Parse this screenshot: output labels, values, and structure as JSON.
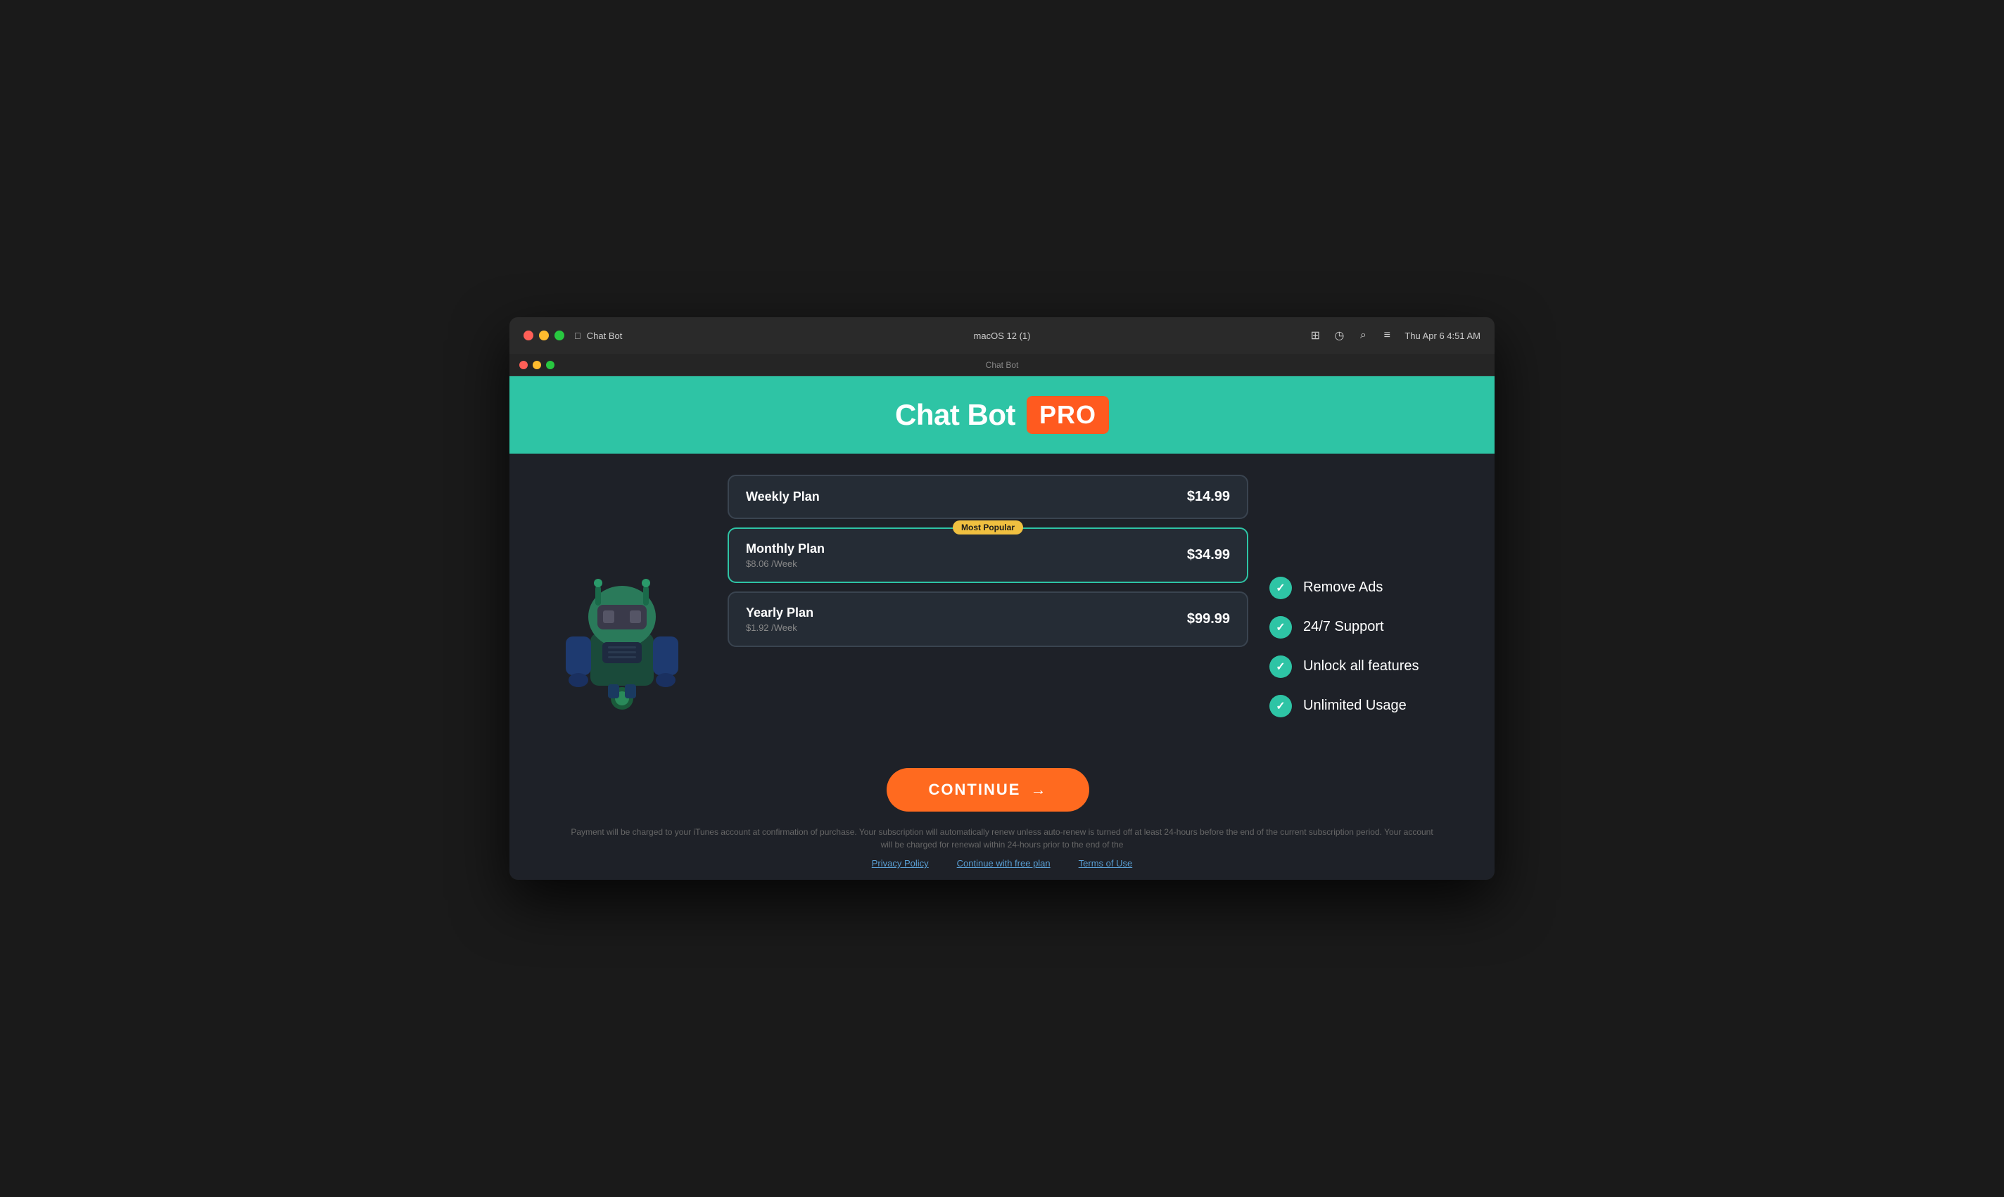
{
  "os": {
    "title": "macOS 12 (1)",
    "app_name": "Chat Bot",
    "time": "Thu Apr 6  4:51 AM",
    "inner_title": "Chat Bot"
  },
  "header": {
    "title": "Chat Bot",
    "badge": "PRO"
  },
  "plans": [
    {
      "id": "weekly",
      "name": "Weekly Plan",
      "price": "$14.99",
      "subtext": "",
      "popular": false,
      "selected": false
    },
    {
      "id": "monthly",
      "name": "Monthly Plan",
      "price": "$34.99",
      "subtext": "$8.06 /Week",
      "popular": true,
      "popular_label": "Most Popular",
      "selected": true
    },
    {
      "id": "yearly",
      "name": "Yearly Plan",
      "price": "$99.99",
      "subtext": "$1.92 /Week",
      "popular": false,
      "selected": false
    }
  ],
  "continue_button": {
    "label": "CONTINUE",
    "arrow": "→"
  },
  "features": [
    {
      "text": "Remove Ads"
    },
    {
      "text": "24/7 Support"
    },
    {
      "text": "Unlock all features"
    },
    {
      "text": "Unlimited Usage"
    }
  ],
  "payment_info": "Payment will be charged to your iTunes account at confirmation of purchase. Your subscription will automatically renew unless auto-renew is turned off at least 24-hours before the end of the current subscription period. Your account will be charged for renewal within 24-hours prior to the end of the",
  "footer_links": [
    {
      "label": "Privacy Policy"
    },
    {
      "label": "Continue with free plan"
    },
    {
      "label": "Terms of Use"
    }
  ],
  "colors": {
    "accent_teal": "#2ec4a5",
    "accent_orange": "#ff6a1f",
    "pro_red": "#ff5a1f",
    "popular_yellow": "#f0c040"
  }
}
